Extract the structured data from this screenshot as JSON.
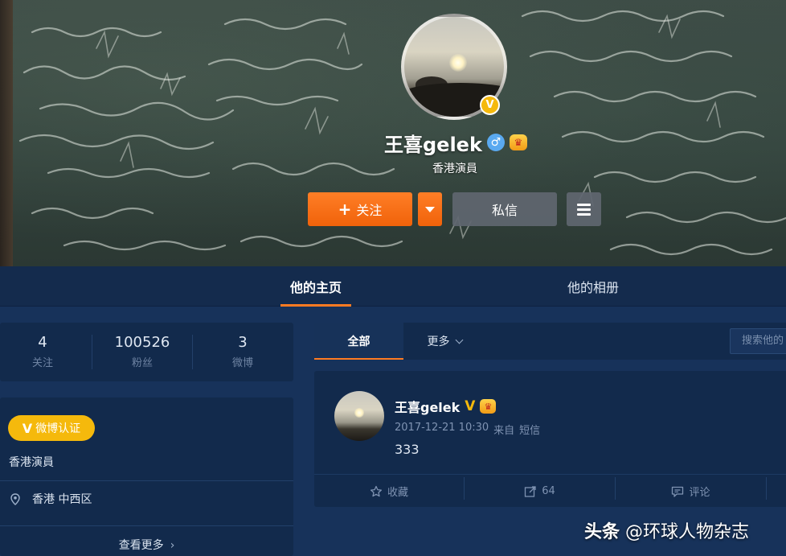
{
  "profile": {
    "name": "王喜gelek",
    "description": "香港演員",
    "verify_letter": "V",
    "gender_symbol": "♂"
  },
  "actions": {
    "follow_label": "关注",
    "message_label": "私信"
  },
  "tabs": {
    "home": "他的主页",
    "album": "他的相册"
  },
  "stats": [
    {
      "value": "4",
      "label": "关注"
    },
    {
      "value": "100526",
      "label": "粉丝"
    },
    {
      "value": "3",
      "label": "微博"
    }
  ],
  "info": {
    "verify_label": "微博认证",
    "description": "香港演員",
    "location": "香港 中西区",
    "see_more": "查看更多"
  },
  "feed": {
    "filter_all": "全部",
    "filter_more": "更多",
    "search_placeholder": "搜索他的"
  },
  "post": {
    "author": "王喜gelek",
    "time": "2017-12-21 10:30",
    "source_prefix": "来自",
    "source": "短信",
    "text": "333",
    "actions": {
      "favorite": "收藏",
      "repost_count": "64",
      "comment": "评论"
    }
  },
  "watermark": {
    "brand": "头条",
    "handle": "@环球人物杂志"
  },
  "colors": {
    "accent_orange": "#ff7b22",
    "verify_gold": "#f5b90c",
    "page_bg": "#17325a",
    "card_bg": "#122a4c"
  }
}
